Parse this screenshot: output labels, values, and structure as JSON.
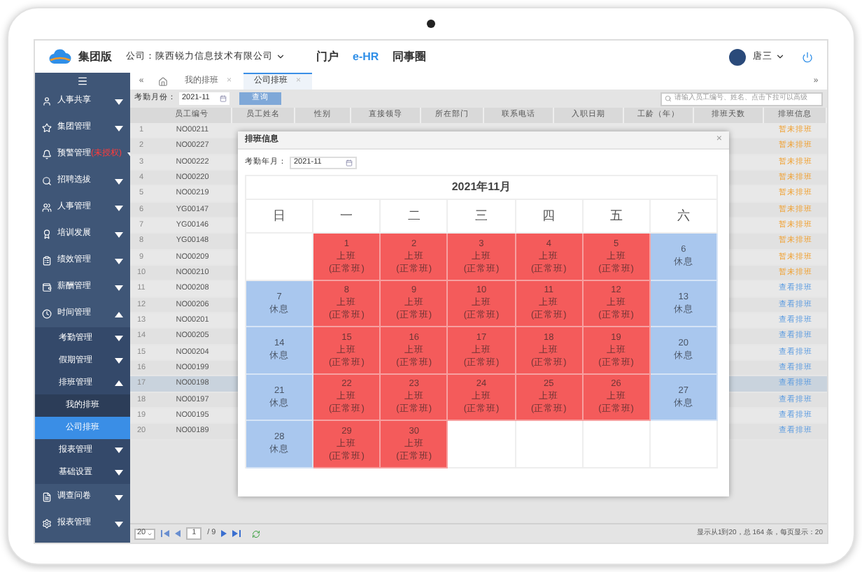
{
  "header": {
    "logo_text": "集团版",
    "company": "公司：陕西锐力信息技术有限公司",
    "nav": [
      {
        "label": "门户",
        "selected": false
      },
      {
        "label": "e-HR",
        "selected": true
      },
      {
        "label": "同事圈",
        "selected": false
      }
    ],
    "user": "唐三"
  },
  "sidebar": {
    "items": [
      {
        "label": "人事共享",
        "expanded": false
      },
      {
        "label": "集团管理",
        "expanded": false
      },
      {
        "label": "预警管理",
        "note": "(未授权)",
        "expanded": false
      },
      {
        "label": "招聘选拔",
        "expanded": false
      },
      {
        "label": "人事管理",
        "expanded": false
      },
      {
        "label": "培训发展",
        "expanded": false
      },
      {
        "label": "绩效管理",
        "expanded": false
      },
      {
        "label": "薪酬管理",
        "expanded": false
      },
      {
        "label": "时间管理",
        "expanded": true,
        "children": [
          {
            "label": "考勤管理",
            "expanded": false
          },
          {
            "label": "假期管理",
            "expanded": false
          },
          {
            "label": "排班管理",
            "expanded": true,
            "children": [
              {
                "label": "我的排班",
                "selected": false
              },
              {
                "label": "公司排班",
                "selected": true
              }
            ]
          },
          {
            "label": "报表管理",
            "expanded": false
          },
          {
            "label": "基础设置",
            "expanded": false
          }
        ]
      },
      {
        "label": "调查问卷",
        "expanded": false
      },
      {
        "label": "报表管理",
        "expanded": false
      }
    ]
  },
  "tab_bar": {
    "collapse": "«",
    "expand": "»",
    "close": "×"
  },
  "tabs": [
    {
      "label": "我的排班",
      "selected": false
    },
    {
      "label": "公司排班",
      "selected": true
    }
  ],
  "filter": {
    "label": "考勤月份：",
    "value": "2021-11",
    "button": "查询",
    "search_placeholder": "请输入员工编号、姓名、点击下拉可以高级"
  },
  "table": {
    "columns": [
      "员工编号",
      "员工姓名",
      "性别",
      "直接领导",
      "所在部门",
      "联系电话",
      "入职日期",
      "工龄（年）",
      "排班天数",
      "排班信息"
    ],
    "rows": [
      {
        "number": "1",
        "id": "NO00211",
        "status": "暂未排班",
        "kind": "pending",
        "selected": false
      },
      {
        "number": "2",
        "id": "NO00227",
        "status": "暂未排班",
        "kind": "pending",
        "selected": false
      },
      {
        "number": "3",
        "id": "NO00222",
        "status": "暂未排班",
        "kind": "pending",
        "selected": false
      },
      {
        "number": "4",
        "id": "NO00220",
        "status": "暂未排班",
        "kind": "pending",
        "selected": false
      },
      {
        "number": "5",
        "id": "NO00219",
        "status": "暂未排班",
        "kind": "pending",
        "selected": false
      },
      {
        "number": "6",
        "id": "YG00147",
        "status": "暂未排班",
        "kind": "pending",
        "selected": false
      },
      {
        "number": "7",
        "id": "YG00146",
        "status": "暂未排班",
        "kind": "pending",
        "selected": false
      },
      {
        "number": "8",
        "id": "YG00148",
        "status": "暂未排班",
        "kind": "pending",
        "selected": false
      },
      {
        "number": "9",
        "id": "NO00209",
        "status": "暂未排班",
        "kind": "pending",
        "selected": false
      },
      {
        "number": "10",
        "id": "NO00210",
        "status": "暂未排班",
        "kind": "pending",
        "selected": false
      },
      {
        "number": "11",
        "id": "NO00208",
        "status": "查看排班",
        "kind": "done",
        "selected": false
      },
      {
        "number": "12",
        "id": "NO00206",
        "status": "查看排班",
        "kind": "done",
        "selected": false
      },
      {
        "number": "13",
        "id": "NO00201",
        "status": "查看排班",
        "kind": "done",
        "selected": false
      },
      {
        "number": "14",
        "id": "NO00205",
        "status": "查看排班",
        "kind": "done",
        "selected": false
      },
      {
        "number": "15",
        "id": "NO00204",
        "status": "查看排班",
        "kind": "done",
        "selected": false
      },
      {
        "number": "16",
        "id": "NO00199",
        "status": "查看排班",
        "kind": "done",
        "selected": false
      },
      {
        "number": "17",
        "id": "NO00198",
        "status": "查看排班",
        "kind": "done",
        "selected": true
      },
      {
        "number": "18",
        "id": "NO00197",
        "status": "查看排班",
        "kind": "done",
        "selected": false
      },
      {
        "number": "19",
        "id": "NO00195",
        "status": "查看排班",
        "kind": "done",
        "selected": false
      },
      {
        "number": "20",
        "id": "NO00189",
        "status": "查看排班",
        "kind": "done",
        "selected": false
      }
    ]
  },
  "pager": {
    "page_size": "20",
    "page": "1",
    "total_pages": "/ 9",
    "summary": "显示从1到20，总 164 条，每页显示：20"
  },
  "modal": {
    "title": "排班信息",
    "close": "×",
    "month_label": "考勤年月：",
    "month_value": "2021-11",
    "calendar": {
      "title": "2021年11月",
      "weekdays": [
        "日",
        "一",
        "二",
        "三",
        "四",
        "五",
        "六"
      ],
      "weeks": [
        [
          {
            "kind": "empty"
          },
          {
            "kind": "work",
            "day": "1",
            "shift": "上班",
            "type": "(正常班)"
          },
          {
            "kind": "work",
            "day": "2",
            "shift": "上班",
            "type": "(正常班)"
          },
          {
            "kind": "work",
            "day": "3",
            "shift": "上班",
            "type": "(正常班)"
          },
          {
            "kind": "work",
            "day": "4",
            "shift": "上班",
            "type": "(正常班)"
          },
          {
            "kind": "work",
            "day": "5",
            "shift": "上班",
            "type": "(正常班)"
          },
          {
            "kind": "rest",
            "day": "6",
            "shift": "休息"
          }
        ],
        [
          {
            "kind": "rest",
            "day": "7",
            "shift": "休息"
          },
          {
            "kind": "work",
            "day": "8",
            "shift": "上班",
            "type": "(正常班)"
          },
          {
            "kind": "work",
            "day": "9",
            "shift": "上班",
            "type": "(正常班)"
          },
          {
            "kind": "work",
            "day": "10",
            "shift": "上班",
            "type": "(正常班)"
          },
          {
            "kind": "work",
            "day": "11",
            "shift": "上班",
            "type": "(正常班)"
          },
          {
            "kind": "work",
            "day": "12",
            "shift": "上班",
            "type": "(正常班)"
          },
          {
            "kind": "rest",
            "day": "13",
            "shift": "休息"
          }
        ],
        [
          {
            "kind": "rest",
            "day": "14",
            "shift": "休息"
          },
          {
            "kind": "work",
            "day": "15",
            "shift": "上班",
            "type": "(正常班)"
          },
          {
            "kind": "work",
            "day": "16",
            "shift": "上班",
            "type": "(正常班)"
          },
          {
            "kind": "work",
            "day": "17",
            "shift": "上班",
            "type": "(正常班)"
          },
          {
            "kind": "work",
            "day": "18",
            "shift": "上班",
            "type": "(正常班)"
          },
          {
            "kind": "work",
            "day": "19",
            "shift": "上班",
            "type": "(正常班)"
          },
          {
            "kind": "rest",
            "day": "20",
            "shift": "休息"
          }
        ],
        [
          {
            "kind": "rest",
            "day": "21",
            "shift": "休息"
          },
          {
            "kind": "work",
            "day": "22",
            "shift": "上班",
            "type": "(正常班)"
          },
          {
            "kind": "work",
            "day": "23",
            "shift": "上班",
            "type": "(正常班)"
          },
          {
            "kind": "work",
            "day": "24",
            "shift": "上班",
            "type": "(正常班)"
          },
          {
            "kind": "work",
            "day": "25",
            "shift": "上班",
            "type": "(正常班)"
          },
          {
            "kind": "work",
            "day": "26",
            "shift": "上班",
            "type": "(正常班)"
          },
          {
            "kind": "rest",
            "day": "27",
            "shift": "休息"
          }
        ],
        [
          {
            "kind": "rest",
            "day": "28",
            "shift": "休息"
          },
          {
            "kind": "work",
            "day": "29",
            "shift": "上班",
            "type": "(正常班)"
          },
          {
            "kind": "work",
            "day": "30",
            "shift": "上班",
            "type": "(正常班)"
          },
          {
            "kind": "empty"
          },
          {
            "kind": "empty"
          },
          {
            "kind": "empty"
          },
          {
            "kind": "empty"
          }
        ]
      ]
    }
  }
}
